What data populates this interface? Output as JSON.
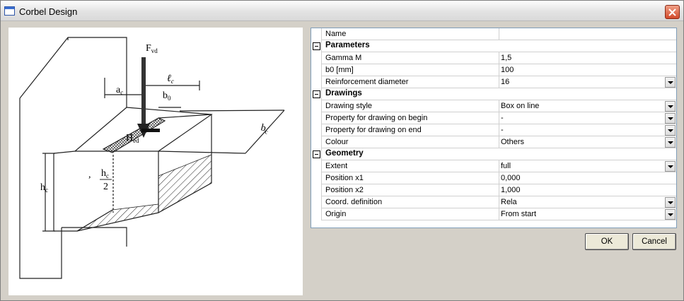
{
  "window": {
    "title": "Corbel Design",
    "icon": "window-icon",
    "close_icon": "close-icon"
  },
  "drawing": {
    "labels": {
      "fvd": "F",
      "fvd_sub": "vd",
      "ac": "a",
      "ac_sub": "c",
      "lc": "ℓ",
      "lc_sub": "c",
      "b0": "b",
      "b0_sub": "0",
      "hed": "H",
      "hed_sub": "ed",
      "bc": "b",
      "bc_sub": "c",
      "hc": "h",
      "hc_sub": "c",
      "hc2_num": "h",
      "hc2_sub": "c",
      "hc2_den": "2",
      "comma": ","
    }
  },
  "grid": {
    "rows": [
      {
        "kind": "header",
        "name": "Name",
        "value": ""
      },
      {
        "kind": "category",
        "name": "Parameters"
      },
      {
        "kind": "prop",
        "name": "Gamma M",
        "value": "1,5",
        "dropdown": false
      },
      {
        "kind": "prop",
        "name": "b0 [mm]",
        "value": "100",
        "dropdown": false
      },
      {
        "kind": "prop",
        "name": "Reinforcement diameter",
        "value": "16",
        "dropdown": true
      },
      {
        "kind": "category",
        "name": "Drawings"
      },
      {
        "kind": "prop",
        "name": "Drawing style",
        "value": "Box on line",
        "dropdown": true
      },
      {
        "kind": "prop",
        "name": "Property for drawing on begin",
        "value": "-",
        "dropdown": true
      },
      {
        "kind": "prop",
        "name": "Property for drawing on end",
        "value": "-",
        "dropdown": true
      },
      {
        "kind": "prop",
        "name": "Colour",
        "value": "Others",
        "dropdown": true
      },
      {
        "kind": "category",
        "name": "Geometry"
      },
      {
        "kind": "prop",
        "name": "Extent",
        "value": "full",
        "dropdown": true
      },
      {
        "kind": "prop",
        "name": "Position x1",
        "value": "0,000",
        "dropdown": false
      },
      {
        "kind": "prop",
        "name": "Position x2",
        "value": "1,000",
        "dropdown": false
      },
      {
        "kind": "prop",
        "name": "Coord. definition",
        "value": "Rela",
        "dropdown": true
      },
      {
        "kind": "prop",
        "name": "Origin",
        "value": "From start",
        "dropdown": true
      }
    ]
  },
  "buttons": {
    "ok": "OK",
    "cancel": "Cancel"
  }
}
